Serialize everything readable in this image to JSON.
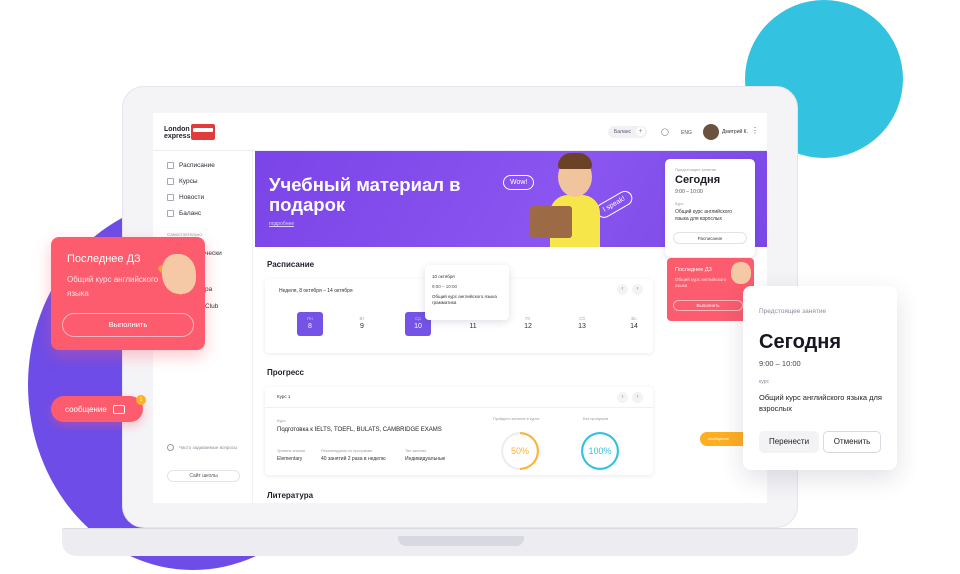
{
  "header": {
    "logo_line1": "London",
    "logo_line2": "express",
    "balance_label": "Баланс",
    "lang": "ENG",
    "user_name": "Дмитрий К."
  },
  "sidebar": {
    "items": [
      {
        "label": "Расписание"
      },
      {
        "label": "Курсы"
      },
      {
        "label": "Новости"
      },
      {
        "label": "Баланс"
      }
    ],
    "subheading": "Самостоятельно",
    "partial_items": [
      "чески",
      "ра",
      "Club"
    ],
    "faq": "Часто задаваемые вопросы",
    "site_button": "Сайт школы"
  },
  "banner": {
    "title": "Учебный материал в подарок",
    "link": "подробнее",
    "bubble_wow": "Wow!",
    "bubble_speak": "I speak!"
  },
  "upcoming_small": {
    "label": "Предстоящее занятие",
    "day": "Сегодня",
    "time": "9:00 – 10:00",
    "course_label": "Курс",
    "course": "Общий курс английского языка для взрослых",
    "button": "Расписание"
  },
  "schedule": {
    "title": "Расписание",
    "week": "Неделя, 8 октября – 14 октября",
    "days": [
      {
        "name": "Пн",
        "num": "8",
        "selected": true
      },
      {
        "name": "Вт",
        "num": "9",
        "selected": false
      },
      {
        "name": "Ср",
        "num": "10",
        "selected": true
      },
      {
        "name": "Чт",
        "num": "11",
        "selected": false
      },
      {
        "name": "Пт",
        "num": "12",
        "selected": false
      },
      {
        "name": "Сб",
        "num": "13",
        "selected": false
      },
      {
        "name": "Вс",
        "num": "14",
        "selected": false
      }
    ],
    "tooltip": {
      "date": "10 октября",
      "time": "9:00 – 10:00",
      "course": "Общий курс английского языка грамматика"
    }
  },
  "progress": {
    "title": "Прогресс",
    "course_select": "Курс 1",
    "kurs_label": "Курс",
    "course_title": "Подготовка к IELTS, TOEFL, BULATS, CAMBRIDGE EXAMS",
    "meta": [
      {
        "label": "Уровень знания",
        "value": "Elementary"
      },
      {
        "label": "Рекомендуемо по программе",
        "value": "40 занятий 2 раза в неделю"
      },
      {
        "label": "Тип занятия",
        "value": "Индивидуальные"
      }
    ],
    "ring1_label": "Пройдено занятие в курсе",
    "ring1_value": "50%",
    "ring1_fraction": 0.5,
    "ring2_label": "Без пропусков",
    "ring2_value": "100%",
    "ring2_fraction": 1.0
  },
  "literature": {
    "title": "Литература"
  },
  "hw_card": {
    "title": "Последнее ДЗ",
    "subtitle": "Общий курс английского языка",
    "button": "Выполнить"
  },
  "hw_mini": {
    "title": "Последнее ДЗ",
    "subtitle": "Общий курс английского языка",
    "button": "Выполнить"
  },
  "message_pill": {
    "label": "сообщение",
    "badge": "1"
  },
  "yellow_pill": {
    "label": "сообщение"
  },
  "upcoming_big": {
    "label": "Предстоящее занятие",
    "day": "Сегодня",
    "time": "9:00 – 10:00",
    "course_label": "курс",
    "course": "Общий курс английского языка для взрослых",
    "btn_move": "Перенести",
    "btn_cancel": "Отменить"
  },
  "colors": {
    "accent_purple": "#7453e6",
    "coral": "#fc5c6d",
    "cyan": "#33c2df",
    "ring_orange": "#ffb23a",
    "ring_teal": "#33c2df",
    "yellow": "#ffae21"
  }
}
